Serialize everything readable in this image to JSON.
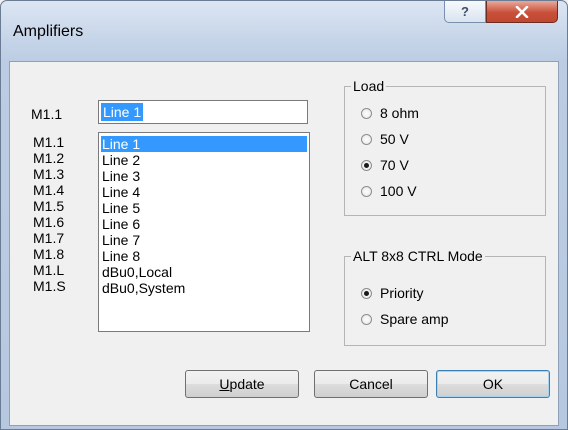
{
  "window": {
    "title": "Amplifiers"
  },
  "edit": {
    "label": "M1.1",
    "value": "Line 1"
  },
  "list": {
    "labels": [
      "M1.1",
      "M1.2",
      "M1.3",
      "M1.4",
      "M1.5",
      "M1.6",
      "M1.7",
      "M1.8",
      "M1.L",
      "M1.S"
    ],
    "items": [
      "Line 1",
      "Line 2",
      "Line 3",
      "Line 4",
      "Line 5",
      "Line 6",
      "Line 7",
      "Line 8",
      "dBu0,Local",
      "dBu0,System"
    ],
    "selected_index": 0
  },
  "load": {
    "title": "Load",
    "options": [
      "8 ohm",
      "50 V",
      "70 V",
      "100 V"
    ],
    "selected": "70 V"
  },
  "ctrl_mode": {
    "title": "ALT 8x8 CTRL Mode",
    "options": [
      "Priority",
      "Spare amp"
    ],
    "selected": "Priority"
  },
  "buttons": {
    "update": "Update",
    "cancel": "Cancel",
    "ok": "OK"
  },
  "icons": {
    "help": "help-icon",
    "close": "close-icon"
  },
  "colors": {
    "selection": "#3399ff",
    "close_button": "#c8503a"
  }
}
